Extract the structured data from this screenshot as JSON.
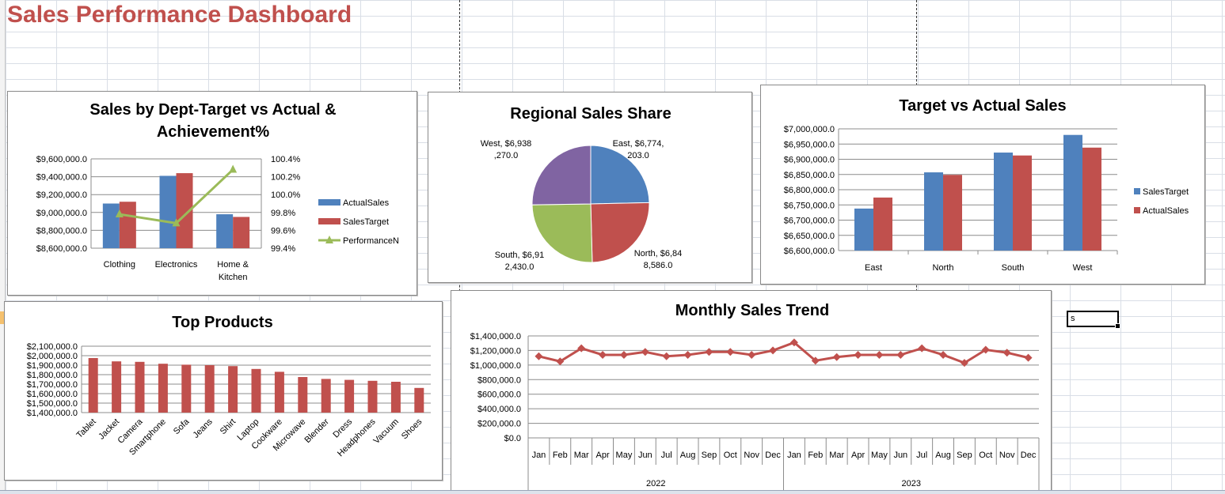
{
  "dashboard": {
    "title": "Sales Performance Dashboard"
  },
  "active_cell": {
    "value": "s"
  },
  "colors": {
    "blue": "#4f81bd",
    "red": "#c0504d",
    "green": "#9bbb59",
    "purple": "#8064a2",
    "title": "#c0504d"
  },
  "chart_data": [
    {
      "id": "dept",
      "type": "bar",
      "title": "Sales by Dept-Target vs Actual & Achievement%",
      "title_lines": [
        "Sales by Dept-Target vs Actual &",
        "Achievement%"
      ],
      "categories": [
        "Clothing",
        "Electronics",
        "Home & Kitchen"
      ],
      "category_label_lines": [
        [
          "Clothing"
        ],
        [
          "Electronics"
        ],
        [
          "Home &",
          "Kitchen"
        ]
      ],
      "series": [
        {
          "name": "ActualSales",
          "type": "bar",
          "axis": "primary",
          "color": "#4f81bd",
          "values": [
            9100000,
            9410000,
            8980000
          ]
        },
        {
          "name": "SalesTarget",
          "type": "bar",
          "axis": "primary",
          "color": "#c0504d",
          "values": [
            9120000,
            9440000,
            8950000
          ]
        },
        {
          "name": "PerformanceN",
          "type": "line",
          "axis": "secondary",
          "color": "#9bbb59",
          "marker": "triangle",
          "values": [
            99.78,
            99.68,
            100.28
          ]
        }
      ],
      "y_ticks": [
        "$9,600,000.0",
        "$9,400,000.0",
        "$9,200,000.0",
        "$9,000,000.0",
        "$8,800,000.0",
        "$8,600,000.0"
      ],
      "ylim": [
        8600000,
        9600000
      ],
      "y2_ticks": [
        "100.4%",
        "100.2%",
        "100.0%",
        "99.8%",
        "99.6%",
        "99.4%"
      ],
      "y2lim": [
        99.4,
        100.4
      ],
      "legend": "right",
      "grid": true
    },
    {
      "id": "region",
      "type": "pie",
      "title": "Regional Sales Share",
      "slices": [
        {
          "name": "East",
          "value": 6774203,
          "color": "#4f81bd",
          "label_lines": [
            "East, $6,774,",
            "203.0"
          ]
        },
        {
          "name": "North",
          "value": 6848586,
          "color": "#c0504d",
          "label_lines": [
            "North, $6,84",
            "8,586.0"
          ]
        },
        {
          "name": "South",
          "value": 6912430,
          "color": "#9bbb59",
          "label_lines": [
            "South, $6,91",
            "2,430.0"
          ]
        },
        {
          "name": "West",
          "value": 6938270,
          "color": "#8064a2",
          "label_lines": [
            "West, $6,938",
            ",270.0"
          ]
        }
      ]
    },
    {
      "id": "target",
      "type": "bar",
      "title": "Target vs Actual Sales",
      "categories": [
        "East",
        "North",
        "South",
        "West"
      ],
      "series": [
        {
          "name": "SalesTarget",
          "color": "#4f81bd",
          "values": [
            6738000,
            6857000,
            6922000,
            6980000
          ]
        },
        {
          "name": "ActualSales",
          "color": "#c0504d",
          "values": [
            6774203,
            6848586,
            6912430,
            6938270
          ]
        }
      ],
      "y_ticks": [
        "$7,000,000.0",
        "$6,950,000.0",
        "$6,900,000.0",
        "$6,850,000.0",
        "$6,800,000.0",
        "$6,750,000.0",
        "$6,700,000.0",
        "$6,650,000.0",
        "$6,600,000.0"
      ],
      "ylim": [
        6600000,
        7000000
      ],
      "legend": "right",
      "grid": true
    },
    {
      "id": "products",
      "type": "bar",
      "title": "Top Products",
      "categories": [
        "Tablet",
        "Jacket",
        "Camera",
        "Smartphone",
        "Sofa",
        "Jeans",
        "Shirt",
        "Laptop",
        "Cookware",
        "Microwave",
        "Blender",
        "Dress",
        "Headphones",
        "Vacuum",
        "Shoes"
      ],
      "values": [
        1975000,
        1940000,
        1935000,
        1915000,
        1905000,
        1900000,
        1890000,
        1860000,
        1830000,
        1775000,
        1755000,
        1745000,
        1735000,
        1725000,
        1660000
      ],
      "color": "#c0504d",
      "y_ticks": [
        "$2,100,000.0",
        "$2,000,000.0",
        "$1,900,000.0",
        "$1,800,000.0",
        "$1,700,000.0",
        "$1,600,000.0",
        "$1,500,000.0",
        "$1,400,000.0"
      ],
      "ylim": [
        1400000,
        2100000
      ],
      "grid": true
    },
    {
      "id": "monthly",
      "type": "line",
      "title": "Monthly Sales Trend",
      "months": [
        "Jan",
        "Feb",
        "Mar",
        "Apr",
        "May",
        "Jun",
        "Jul",
        "Aug",
        "Sep",
        "Oct",
        "Nov",
        "Dec",
        "Jan",
        "Feb",
        "Mar",
        "Apr",
        "May",
        "Jun",
        "Jul",
        "Aug",
        "Sep",
        "Oct",
        "Nov",
        "Dec"
      ],
      "years": [
        "2022",
        "2023"
      ],
      "values": [
        1120000,
        1050000,
        1230000,
        1140000,
        1140000,
        1180000,
        1120000,
        1140000,
        1180000,
        1180000,
        1140000,
        1200000,
        1310000,
        1060000,
        1110000,
        1140000,
        1140000,
        1140000,
        1230000,
        1140000,
        1030000,
        1210000,
        1170000,
        1100000
      ],
      "color": "#c0504d",
      "marker": "diamond",
      "y_ticks": [
        "$1,400,000.0",
        "$1,200,000.0",
        "$1,000,000.0",
        "$800,000.0",
        "$600,000.0",
        "$400,000.0",
        "$200,000.0",
        "$0.0"
      ],
      "ylim": [
        0,
        1400000
      ],
      "grid": true
    }
  ]
}
